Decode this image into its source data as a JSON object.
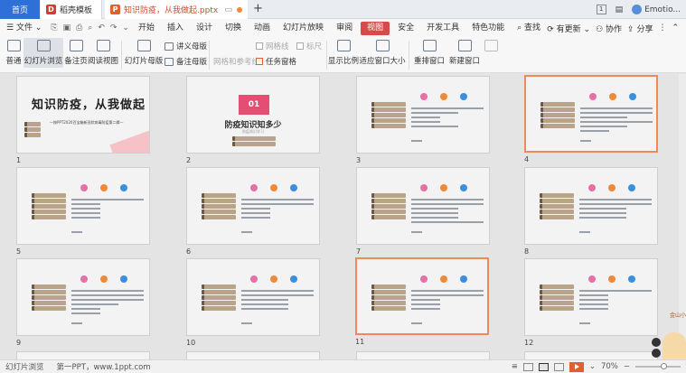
{
  "tabs": {
    "home": "首页",
    "templates": "稻壳模板",
    "file": "知识防疫，从我做起.pptx",
    "new_tab": "+"
  },
  "window": {
    "box": "1",
    "user": "Emotio..."
  },
  "menu": {
    "file": "文件",
    "items": [
      "开始",
      "插入",
      "设计",
      "切换",
      "动画",
      "幻灯片放映",
      "审阅",
      "视图",
      "安全",
      "开发工具",
      "特色功能"
    ],
    "active": "视图",
    "search": "查找",
    "updates": "有更新",
    "collab": "协作",
    "share": "分享"
  },
  "ribbon": {
    "normal": "普通",
    "slide_browse": "幻灯片浏览",
    "notes_page": "备注页",
    "reading_view": "阅读视图",
    "slide_master": "幻灯片母版",
    "handout_master": "讲义母版",
    "notes_master": "备注母版",
    "gridlines": "网格线",
    "ruler": "标尺",
    "guides": "网格和参考线",
    "task_pane": "任务窗格",
    "show_ratio": "显示比例",
    "fit_window": "适应窗口大小",
    "arrange": "重排窗口",
    "new_window": "新建窗口"
  },
  "slides": {
    "cover_title": "知识防疫，从我做起",
    "cover_sub": "—按PPT2020百宝箱新冠状病毒防疫第二辑—",
    "s2_badge": "01",
    "s2_title": "防疫知识知多少",
    "s2_sub": "防疫知识学习",
    "numbers": [
      "1",
      "2",
      "3",
      "4",
      "5",
      "6",
      "7",
      "8",
      "9",
      "10",
      "11",
      "12"
    ]
  },
  "status": {
    "view": "幻灯片浏览",
    "theme": "第一PPT，www.1ppt.com",
    "zoom": "70%"
  },
  "assistant": {
    "label": "金山小"
  }
}
